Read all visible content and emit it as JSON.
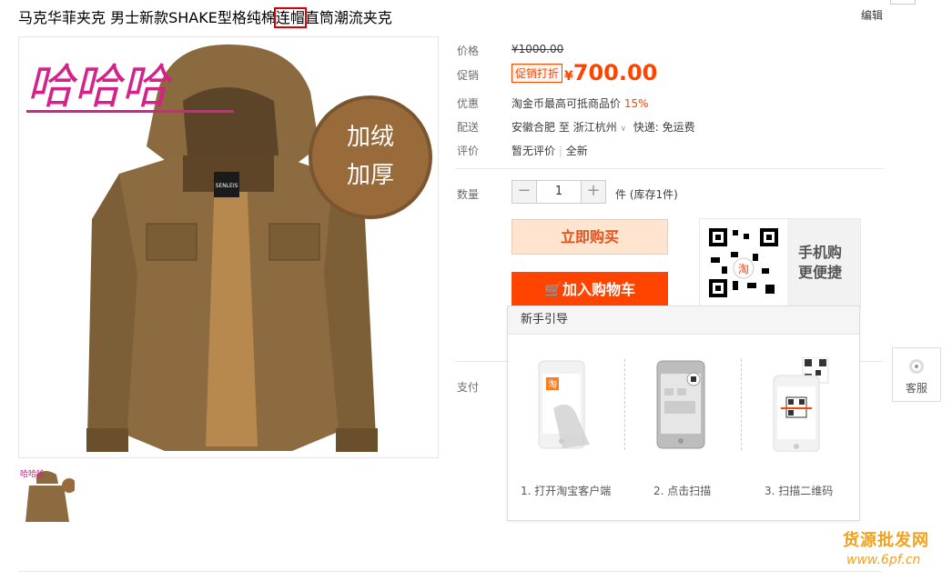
{
  "product": {
    "title_before": "马克华菲夹克 男士新款SHAKE型格纯棉",
    "title_highlight": "连帽",
    "title_after": "直筒潮流夹克",
    "edit_label": "编辑"
  },
  "gallery": {
    "overlay_text": "哈哈哈",
    "badge_line1": "加绒",
    "badge_line2": "加厚",
    "collar_label": "SENLEIS",
    "thumb_text": "哈哈哈"
  },
  "details": {
    "price_label": "价格",
    "price_original": "¥1000.00",
    "promo_label": "促销",
    "promo_tag": "促销打折",
    "currency": "¥",
    "promo_price": "700.00",
    "discount_label": "优惠",
    "discount_text": "淘金币最高可抵商品价",
    "discount_pct": "15%",
    "ship_label": "配送",
    "ship_from": "安徽合肥",
    "ship_to_word": "至",
    "ship_to": "浙江杭州",
    "ship_method": "快递: 免运费",
    "rating_label": "评价",
    "rating_none": "暂无评价",
    "rating_new": "全新"
  },
  "quantity": {
    "label": "数量",
    "minus": "−",
    "value": "1",
    "plus": "+",
    "unit": "件 (库存1件)"
  },
  "actions": {
    "buy_now": "立即购买",
    "add_to_cart": "加入购物车"
  },
  "mobile": {
    "line1": "手机购",
    "line2": "更便捷",
    "qr_badge": "淘"
  },
  "guide": {
    "title": "新手引导",
    "step1": "1. 打开淘宝客户端",
    "step2": "2. 点击扫描",
    "step3": "3. 扫描二维码",
    "app_badge": "淘"
  },
  "payment": {
    "label": "支付"
  },
  "service": {
    "label": "客服"
  },
  "watermark": {
    "line1": "货源批发网",
    "line2": "www.6pf.cn"
  },
  "colors": {
    "accent": "#ff4400",
    "buy_bg": "#ffe4d0",
    "watermark": "#f3a11a"
  }
}
